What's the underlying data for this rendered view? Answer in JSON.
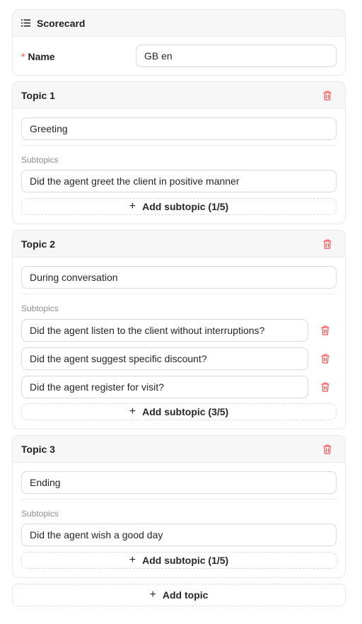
{
  "scorecard": {
    "title": "Scorecard",
    "icon": "list-icon",
    "name_label": "Name",
    "required_mark": "*",
    "name_value": "GB en"
  },
  "topics": [
    {
      "title": "Topic 1",
      "value": "Greeting",
      "subtopics_label": "Subtopics",
      "subtopics": [
        "Did the agent greet the client in positive manner"
      ],
      "add_label": "Add subtopic (1/5)"
    },
    {
      "title": "Topic 2",
      "value": "During conversation",
      "subtopics_label": "Subtopics",
      "subtopics": [
        "Did the agent listen to the client without interruptions?",
        "Did the agent suggest specific discount?",
        "Did the agent register for visit?"
      ],
      "add_label": "Add subtopic (3/5)"
    },
    {
      "title": "Topic 3",
      "value": "Ending",
      "subtopics_label": "Subtopics",
      "subtopics": [
        "Did the agent wish a good day"
      ],
      "add_label": "Add subtopic (1/5)"
    }
  ],
  "add_topic_label": "Add topic",
  "plus_glyph": "+",
  "colors": {
    "danger": "#ff4d4f",
    "border": "#d9d9d9",
    "header_bg": "#f7f7f7"
  }
}
